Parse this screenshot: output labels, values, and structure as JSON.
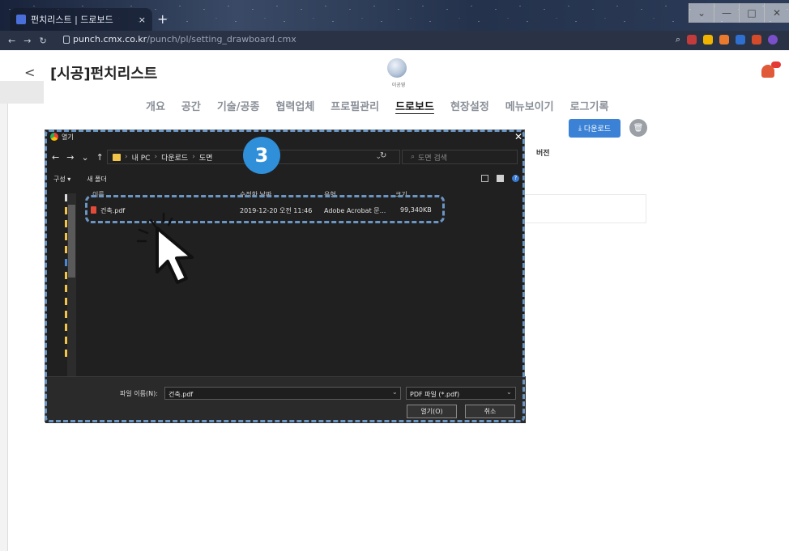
{
  "browser": {
    "tab_title": "펀치리스트 | 드로보드",
    "tab_close": "×",
    "new_tab": "+",
    "url_host": "punch.cmx.co.kr",
    "url_path": "/punch/pl/setting_drawboard.cmx",
    "window_controls": [
      "⌄",
      "—",
      "□",
      "✕"
    ]
  },
  "page": {
    "back": "<",
    "title": "[시공]펀치리스트",
    "avatar_name": "이공영",
    "tabs": [
      "개요",
      "공간",
      "기술/공종",
      "협력업체",
      "프로필관리",
      "드로보드",
      "현장설정",
      "메뉴보이기",
      "로그기록"
    ],
    "active_tab": "드로보드",
    "download_label": "다운로드",
    "version_label": "버전"
  },
  "dialog": {
    "title": "열기",
    "breadcrumb": [
      "내 PC",
      "다운로드",
      "도면"
    ],
    "search_placeholder": "도면 검색",
    "organize": "구성 ▾",
    "new_folder": "새 폴더",
    "columns": [
      "이름",
      "수정한 날짜",
      "유형",
      "크기"
    ],
    "file": {
      "name": "건축.pdf",
      "date": "2019-12-20 오전 11:46",
      "type": "Adobe Acrobat 문...",
      "size": "99,340KB"
    },
    "filename_label": "파일 이름(N):",
    "filename_value": "건축.pdf",
    "filetype_value": "PDF 파일 (*.pdf)",
    "open_button": "열기(O)",
    "cancel_button": "취소"
  },
  "annotation": {
    "step_number": "3"
  },
  "colors": {
    "accent_blue": "#3b82d6",
    "dash_blue": "#6b96c4",
    "dialog_bg": "#202020"
  }
}
